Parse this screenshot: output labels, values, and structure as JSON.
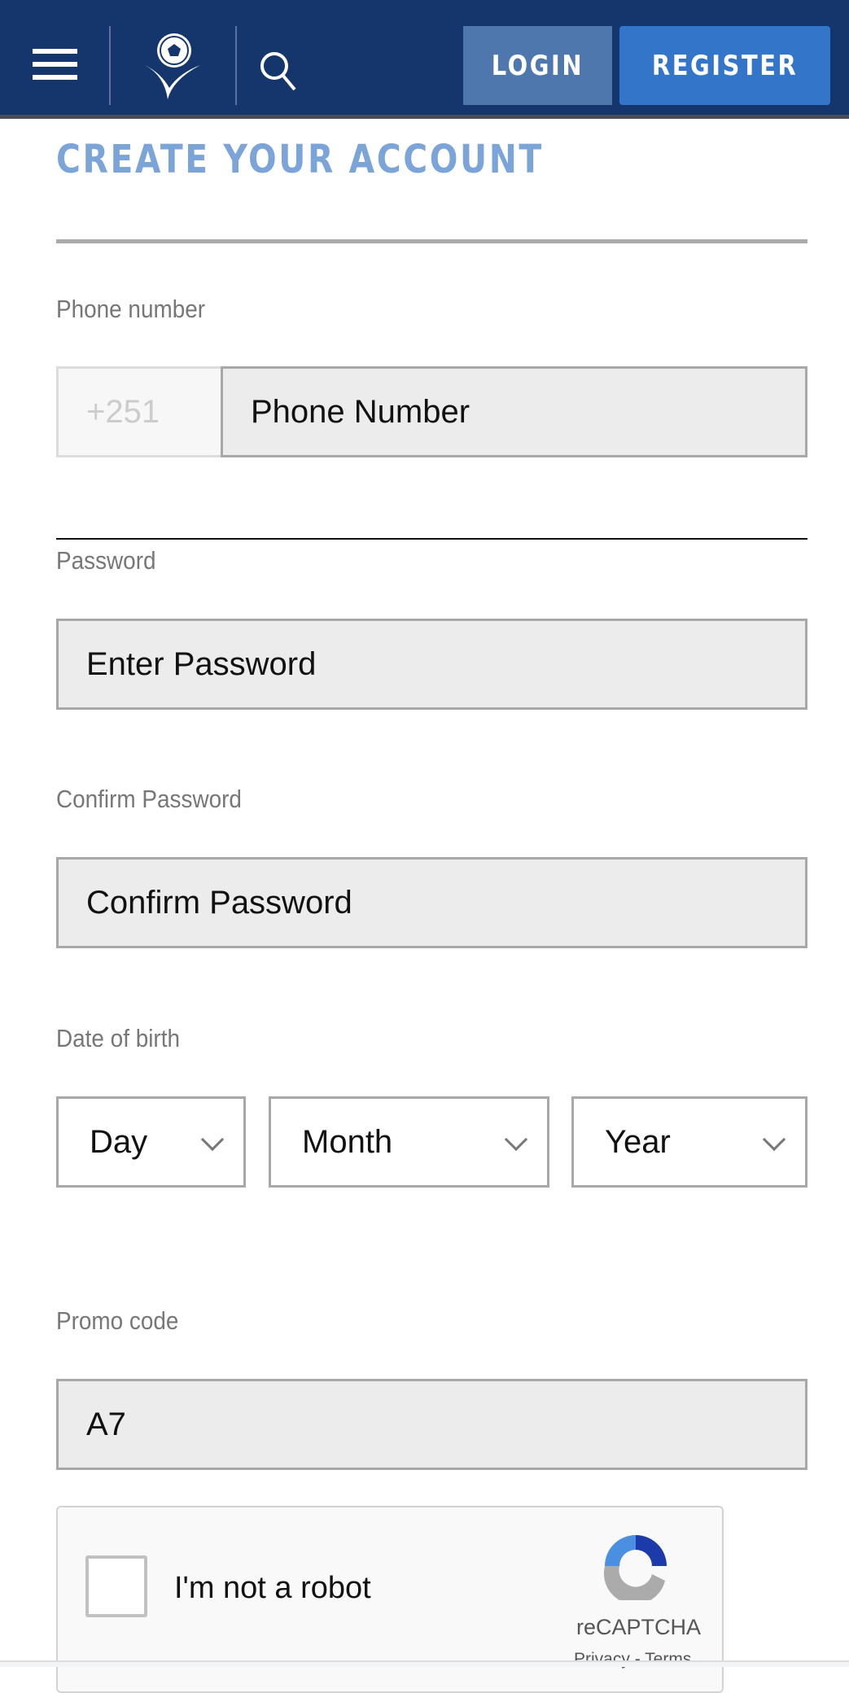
{
  "header": {
    "login_label": "LOGIN",
    "register_label": "REGISTER",
    "colors": {
      "bar": "#15366c",
      "login": "#4e78ad",
      "register": "#3275c9"
    }
  },
  "form": {
    "title": "CREATE YOUR ACCOUNT",
    "phone": {
      "label": "Phone number",
      "prefix": "+251",
      "placeholder": "Phone Number"
    },
    "password": {
      "label": "Password",
      "placeholder": "Enter Password"
    },
    "confirm": {
      "label": "Confirm Password",
      "placeholder": "Confirm Password"
    },
    "dob": {
      "label": "Date of birth",
      "day": "Day",
      "month": "Month",
      "year": "Year"
    },
    "promo": {
      "label": "Promo code",
      "value": "A7"
    },
    "captcha": {
      "text": "I'm not a robot",
      "brand": "reCAPTCHA",
      "privacy": "Privacy",
      "sep": "-",
      "terms": "Terms"
    }
  }
}
